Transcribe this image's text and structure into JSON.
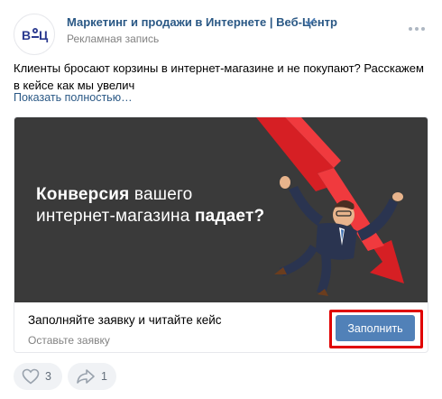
{
  "post": {
    "author": "Маркетинг и продажи в Интернете | Веб-Центр",
    "label": "Рекламная запись",
    "text": "Клиенты бросают корзины в интернет-магазине и не покупают? Расскажем в кейсе как мы увелич",
    "show_more": "Показать полностью…"
  },
  "ad": {
    "headline_part1_bold": "Конверсия",
    "headline_part1_rest": " вашего",
    "headline_part2": "интернет-магазина ",
    "headline_part2_bold": "падает?",
    "cta_title": "Заполняйте заявку и читайте кейс",
    "cta_subtitle": "Оставьте заявку",
    "button_label": "Заполнить"
  },
  "actions": {
    "likes": "3",
    "shares": "1"
  },
  "icons": {
    "avatar": "logo-icon",
    "verified": "verified-check-icon",
    "menu": "more-dots-icon",
    "like": "heart-icon",
    "share": "share-arrow-icon"
  },
  "colors": {
    "link": "#2a5885",
    "button": "#5181b8",
    "highlight_frame": "#e00000",
    "banner_bg": "#3a3a3a",
    "arrow_red": "#e8262a"
  }
}
